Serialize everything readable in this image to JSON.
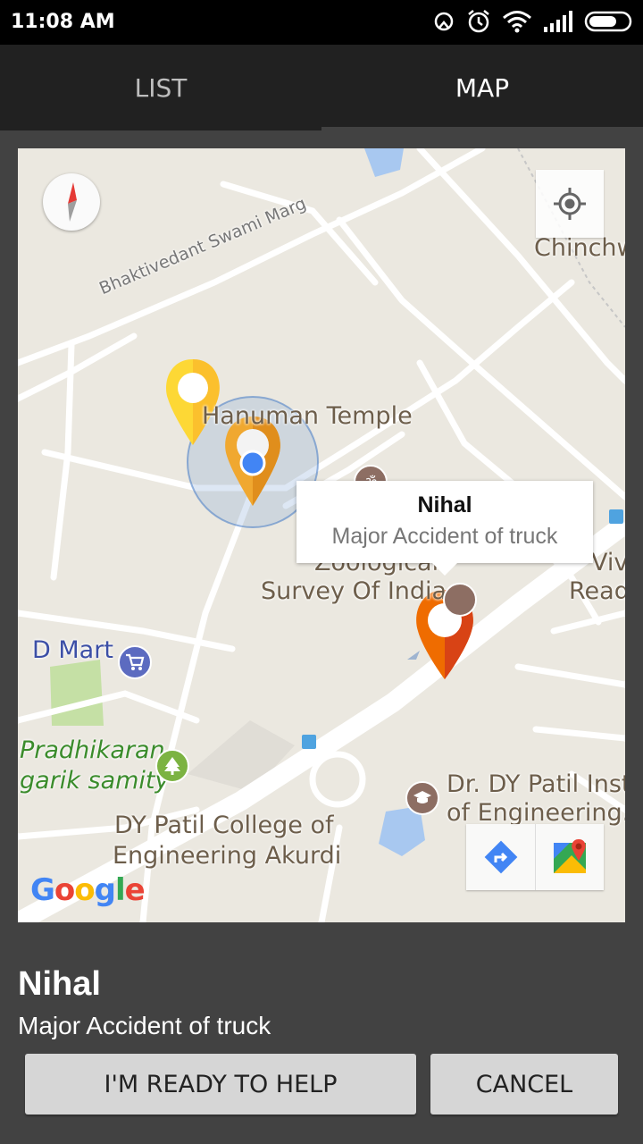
{
  "status": {
    "time": "11:08 AM"
  },
  "tabs": [
    {
      "label": "LIST"
    },
    {
      "label": "MAP"
    }
  ],
  "map": {
    "labels": {
      "road": "Bhaktivedant Swami Marg",
      "temple": "Hanuman Temple",
      "chinchwad": "Chinchw",
      "zoological_1": "Zoological",
      "zoological_2": "Survey Of India",
      "vivek_1": "Viv",
      "vivek_2": "Read",
      "dmart": "D Mart",
      "pradhikaran_1": "Pradhikaran",
      "pradhikaran_2": "garik samity",
      "dypatil_inst_1": "Dr. DY Patil Inst",
      "dypatil_inst_2": "of Engineering...",
      "dypatil_coll_1": "DY Patil College of",
      "dypatil_coll_2": "Engineering Akurdi"
    },
    "info_window": {
      "title": "Nihal",
      "snippet": "Major Accident of truck"
    },
    "logo": "Google",
    "icons": [
      "compass-icon",
      "my-location-icon",
      "directions-icon",
      "google-maps-icon"
    ]
  },
  "detail": {
    "title": "Nihal",
    "subtitle": "Major Accident of truck"
  },
  "actions": {
    "help_label": "I'M READY TO HELP",
    "cancel_label": "CANCEL"
  },
  "colors": {
    "marker_orange": "#ef6c00",
    "marker_amber": "#f0a830",
    "marker_yellow": "#fdd835",
    "location_blue": "#4285f4"
  }
}
